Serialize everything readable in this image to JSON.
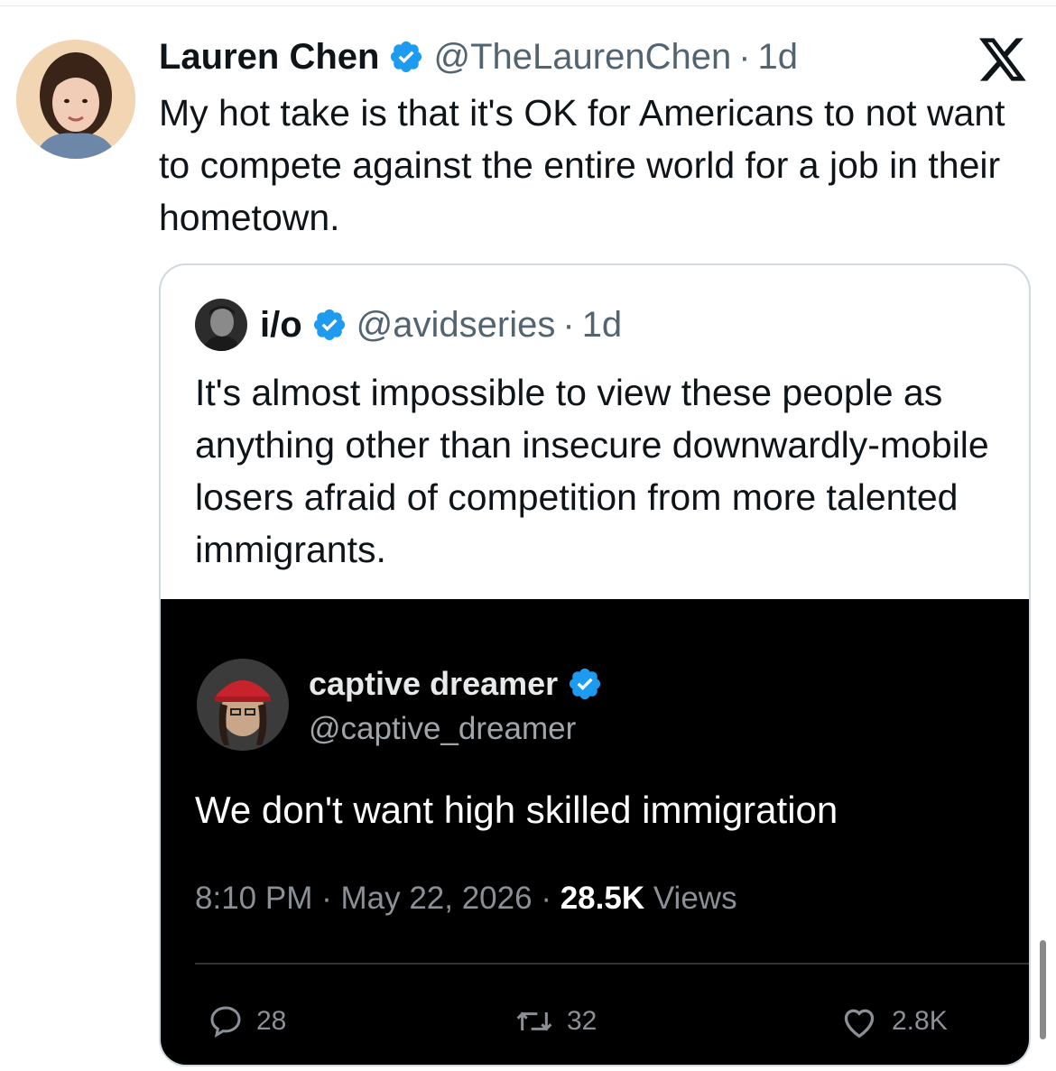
{
  "tweet": {
    "author_name": "Lauren Chen",
    "handle": "@TheLaurenChen",
    "time": "1d",
    "text": "My hot take is that it's OK for Americans to not want to compete against the entire world for a job in their hometown."
  },
  "quoted": {
    "author_name": "i/o",
    "handle": "@avidseries",
    "time": "1d",
    "text": "It's almost impossible to view these people as anything other than insecure downwardly-mobile losers afraid of competition from more talented immigrants."
  },
  "embedded": {
    "author_name": "captive dreamer",
    "handle": "@captive_dreamer",
    "text": "We don't want high skilled immigration",
    "time": "8:10 PM",
    "date": "May 22, 2026",
    "views_count": "28.5K",
    "views_label": "Views",
    "replies": "28",
    "reposts": "32",
    "likes": "2.8K"
  },
  "icons": [
    "verified-badge-icon",
    "x-logo-icon",
    "reply-icon",
    "repost-icon",
    "like-icon"
  ],
  "colors": {
    "verified_blue": "#1d9bf0",
    "text": "#0f1419",
    "muted": "#536471",
    "media_bg": "#000000"
  }
}
